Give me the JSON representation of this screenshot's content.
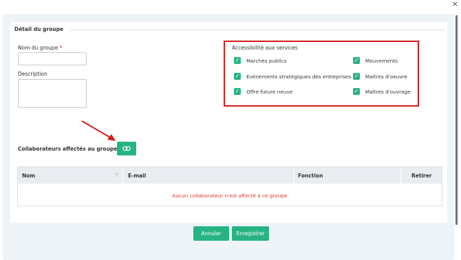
{
  "window": {
    "close_glyph": "×"
  },
  "group": {
    "section_title": "Détail du groupe",
    "name_label": "Nom du groupe",
    "required_mark": "*",
    "name_value": "",
    "description_label": "Description",
    "description_value": ""
  },
  "services": {
    "title": "Accessibilité aux services",
    "items": [
      {
        "label": "Marchés publics",
        "checked": true
      },
      {
        "label": "Evénements stratégiques des entreprises",
        "checked": true
      },
      {
        "label": "Offre future neuve",
        "checked": true
      },
      {
        "label": "Mouvements",
        "checked": true
      },
      {
        "label": "Maîtres d'oeuvre",
        "checked": true
      },
      {
        "label": "Maîtres d'ouvrage",
        "checked": true
      }
    ],
    "check_glyph": "✓",
    "highlight_color": "#d71a1a"
  },
  "collaborators": {
    "title": "Collaborateurs affectés au groupe (0)",
    "link_icon": "link-icon",
    "columns": [
      "Nom",
      "E-mail",
      "Fonction",
      "Retirer"
    ],
    "sort_glyph": "↑",
    "empty_message": "Aucun collaborateur n'est affecté à ce groupe"
  },
  "footer": {
    "cancel_label": "Annuler",
    "save_label": "Enregistrer"
  },
  "colors": {
    "accent": "#27b383",
    "error": "#e0312b",
    "annotation": "#d71a1a"
  }
}
